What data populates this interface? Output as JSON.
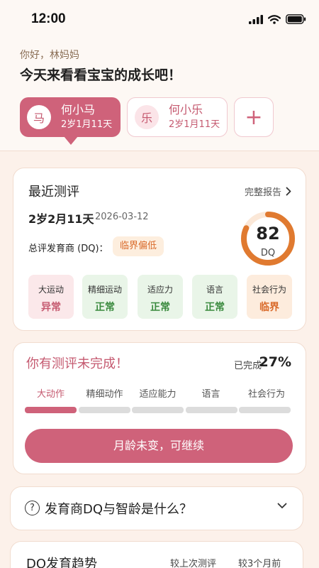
{
  "status_bar": {
    "time": "12:00"
  },
  "header": {
    "greeting": "你好，林妈妈",
    "headline": "今天来看看宝宝的成长吧！"
  },
  "children": [
    {
      "avatar": "马",
      "name": "何小马",
      "age": "2岁1月11天",
      "selected": true
    },
    {
      "avatar": "乐",
      "name": "何小乐",
      "age": "2岁1月11天",
      "selected": false
    }
  ],
  "add_child": {
    "label": "+"
  },
  "recent": {
    "title": "最近测评",
    "report_link": "完整报告",
    "age": "2岁2月11天",
    "date": "2026-03-12",
    "dq_label": "总评发育商 (DQ)：",
    "level": "临界偏低",
    "dq_value": "82",
    "dq_unit": "DQ",
    "dq_fraction": 0.82,
    "domains": [
      {
        "label": "大运动",
        "status": "异常",
        "kind": "abnormal"
      },
      {
        "label": "精细运动",
        "status": "正常",
        "kind": "normal"
      },
      {
        "label": "适应力",
        "status": "正常",
        "kind": "normal"
      },
      {
        "label": "语言",
        "status": "正常",
        "kind": "normal"
      },
      {
        "label": "社会行为",
        "status": "临界",
        "kind": "border"
      }
    ]
  },
  "incomplete": {
    "title": "你有测评未完成！",
    "done_label": "已完成",
    "done_pct": "27%",
    "steps": [
      "大动作",
      "精细动作",
      "适应能力",
      "语言",
      "社会行为"
    ],
    "active_step": 0,
    "cta": "月龄未变，可继续"
  },
  "faq": {
    "icon": "question-circle-icon",
    "question": "发育商DQ与智龄是什么？"
  },
  "trend": {
    "title": "DQ发育趋势",
    "tab1": "较上次测评",
    "tab2": "较3个月前"
  },
  "colors": {
    "brand": "#cf627a",
    "gauge_track": "#fbe8d8",
    "gauge_fill": "#e07a30",
    "normal": "#3a8a3e",
    "abnormal": "#c55a70",
    "border": "#d96a2a"
  }
}
